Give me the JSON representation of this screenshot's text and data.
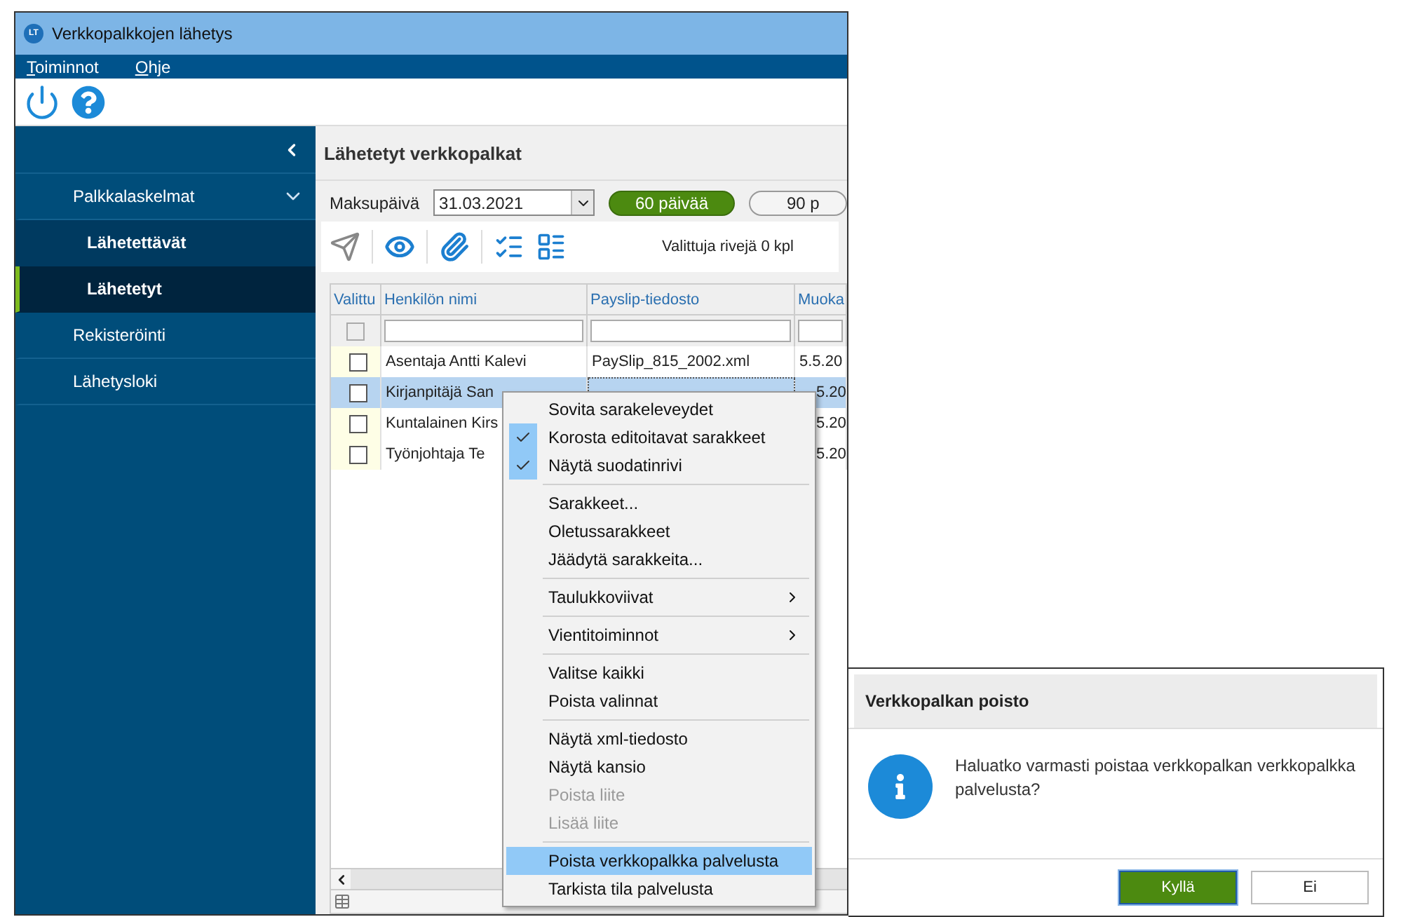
{
  "window": {
    "title": "Verkkopalkkojen lähetys",
    "logo_text": "LT"
  },
  "menu_bar": [
    "Toiminnot",
    "Ohje"
  ],
  "sidebar": {
    "items": [
      {
        "label": "Palkkalaskelmat",
        "expanded": true,
        "selected": false,
        "children": [
          {
            "label": "Lähetettävät",
            "selected": false
          },
          {
            "label": "Lähetetyt",
            "selected": true
          }
        ]
      },
      {
        "label": "Rekisteröinti",
        "selected": false
      },
      {
        "label": "Lähetysloki",
        "selected": false
      }
    ]
  },
  "panel": {
    "title": "Lähetetyt verkkopalkat",
    "date_label": "Maksupäivä",
    "date_value": "31.03.2021",
    "range_buttons": [
      {
        "label": "60 päivää",
        "selected": true
      },
      {
        "label": "90 p",
        "selected": false
      }
    ],
    "selection_count": "Valittuja rivejä 0 kpl"
  },
  "table": {
    "columns": [
      "Valittu",
      "Henkilön nimi",
      "Payslip-tiedosto",
      "Muoka"
    ],
    "filter_checkbox": {
      "checked": false,
      "disabled": true
    },
    "rows": [
      {
        "checked": false,
        "selected": false,
        "name": "Asentaja Antti Kalevi",
        "file": "PaySlip_815_2002.xml",
        "date": "5.5.20"
      },
      {
        "checked": false,
        "selected": true,
        "name": "Kirjanpitäjä San",
        "file": "",
        "date": "5.20"
      },
      {
        "checked": false,
        "selected": false,
        "name": "Kuntalainen Kirs",
        "file": "",
        "date": "5.20"
      },
      {
        "checked": false,
        "selected": false,
        "name": "Työnjohtaja Te",
        "file": "",
        "date": "5.20"
      }
    ]
  },
  "context_menu": [
    {
      "kind": "item",
      "label": "Sovita sarakeleveydet",
      "checked": false,
      "disabled": false,
      "selected": false
    },
    {
      "kind": "item",
      "label": "Korosta editoitavat sarakkeet",
      "checked": true,
      "disabled": false,
      "selected": false
    },
    {
      "kind": "item",
      "label": "Näytä suodatinrivi",
      "checked": true,
      "disabled": false,
      "selected": false
    },
    {
      "kind": "separator"
    },
    {
      "kind": "item",
      "label": "Sarakkeet...",
      "checked": false,
      "disabled": false,
      "selected": false
    },
    {
      "kind": "item",
      "label": "Oletussarakkeet",
      "checked": false,
      "disabled": false,
      "selected": false
    },
    {
      "kind": "item",
      "label": "Jäädytä sarakkeita...",
      "checked": false,
      "disabled": false,
      "selected": false
    },
    {
      "kind": "separator"
    },
    {
      "kind": "submenu",
      "label": "Taulukkoviivat",
      "checked": false,
      "disabled": false,
      "selected": false
    },
    {
      "kind": "separator"
    },
    {
      "kind": "submenu",
      "label": "Vientitoiminnot",
      "checked": false,
      "disabled": false,
      "selected": false
    },
    {
      "kind": "separator"
    },
    {
      "kind": "item",
      "label": "Valitse kaikki",
      "checked": false,
      "disabled": false,
      "selected": false
    },
    {
      "kind": "item",
      "label": "Poista valinnat",
      "checked": false,
      "disabled": false,
      "selected": false
    },
    {
      "kind": "separator"
    },
    {
      "kind": "item",
      "label": "Näytä xml-tiedosto",
      "checked": false,
      "disabled": false,
      "selected": false
    },
    {
      "kind": "item",
      "label": "Näytä kansio",
      "checked": false,
      "disabled": false,
      "selected": false
    },
    {
      "kind": "item",
      "label": "Poista liite",
      "checked": false,
      "disabled": true,
      "selected": false
    },
    {
      "kind": "item",
      "label": "Lisää liite",
      "checked": false,
      "disabled": true,
      "selected": false
    },
    {
      "kind": "separator"
    },
    {
      "kind": "item",
      "label": "Poista verkkopalkka palvelusta",
      "checked": false,
      "disabled": false,
      "selected": true
    },
    {
      "kind": "item",
      "label": "Tarkista tila palvelusta",
      "checked": false,
      "disabled": false,
      "selected": false
    }
  ],
  "dialog": {
    "title": "Verkkopalkan poisto",
    "message": "Haluatko varmasti poistaa verkkopalkan verkkopalkka palvelusta?",
    "buttons": [
      {
        "label": "Kyllä",
        "primary": true
      },
      {
        "label": "Ei",
        "primary": false
      }
    ]
  }
}
